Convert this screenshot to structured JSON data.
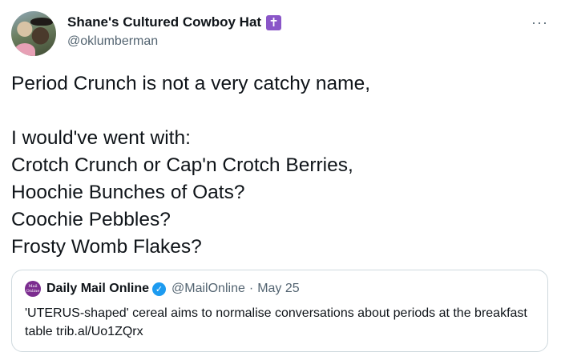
{
  "tweet": {
    "author": {
      "display_name": "Shane's Cultured Cowboy Hat",
      "badge_glyph": "✝",
      "handle": "@oklumberman"
    },
    "more_glyph": "···",
    "lines": [
      "Period Crunch is not a very catchy name,",
      "",
      "I would've went with:",
      "Crotch Crunch or Cap'n Crotch Berries,",
      "Hoochie Bunches of Oats?",
      "Coochie Pebbles?",
      "Frosty Womb Flakes?"
    ]
  },
  "quote": {
    "avatar_text": [
      "Mail",
      "Online"
    ],
    "name": "Daily Mail Online",
    "verified_glyph": "✓",
    "handle": "@MailOnline",
    "separator": "·",
    "date": "May 25",
    "text": "'UTERUS-shaped' cereal aims to normalise conversations about periods at the breakfast table trib.al/Uo1ZQrx"
  },
  "colors": {
    "text": "#0f1419",
    "secondary": "#536471",
    "badge_purple": "#8a56c8",
    "verified_blue": "#1d9bf0",
    "border": "#cfd9de"
  }
}
